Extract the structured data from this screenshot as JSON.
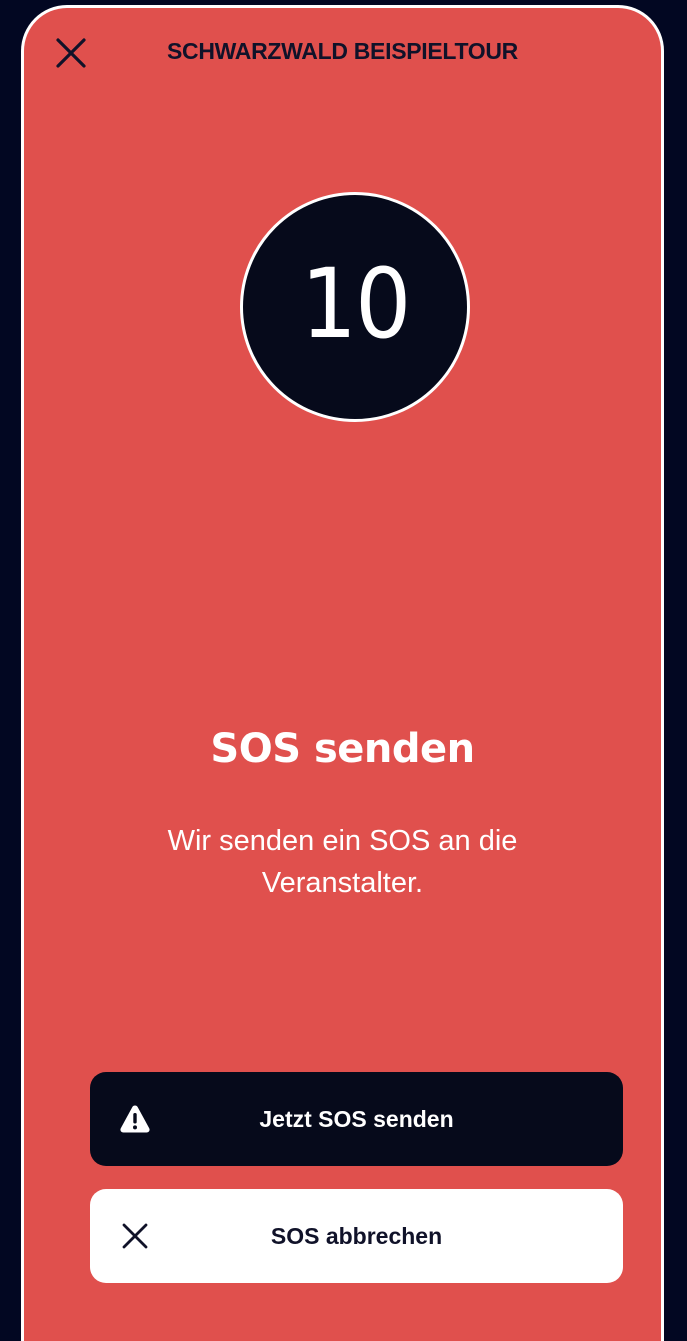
{
  "colors": {
    "background": "#020722",
    "screen": "#e0504d",
    "dark": "#060a1b",
    "light": "#ffffff",
    "header_text": "#101229"
  },
  "header": {
    "title": "SCHWARZWALD BEISPIELTOUR",
    "close_icon": "close-icon"
  },
  "countdown": {
    "value": "10"
  },
  "main": {
    "title": "SOS senden",
    "description": "Wir senden ein SOS an die Veranstalter."
  },
  "actions": {
    "send": {
      "label": "Jetzt SOS senden",
      "icon": "warning-icon"
    },
    "cancel": {
      "label": "SOS abbrechen",
      "icon": "close-icon"
    }
  }
}
